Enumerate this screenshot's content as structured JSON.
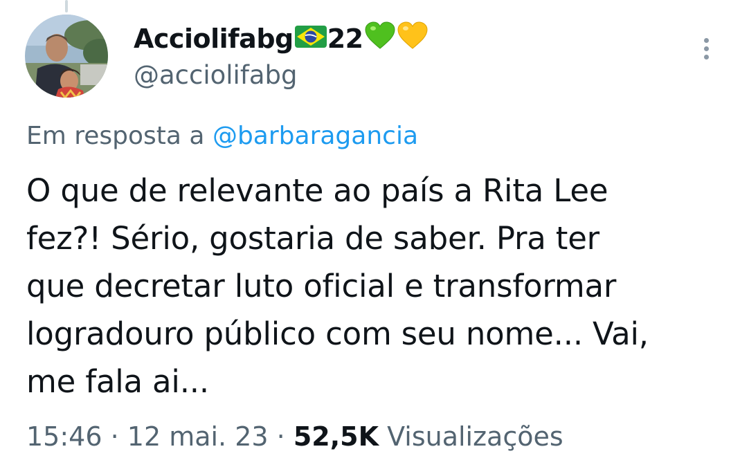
{
  "author": {
    "display_name": "Acciolifabg",
    "name_suffix": "22",
    "name_emojis": [
      "brazil-flag",
      "green-heart",
      "yellow-heart"
    ],
    "handle": "@acciolifabg",
    "avatar_icon": "profile-photo"
  },
  "reply": {
    "prefix": "Em resposta a ",
    "mention": "@barbaragancia"
  },
  "tweet": {
    "lines": [
      "O que de relevante ao país a Rita Lee",
      "fez?! Sério, gostaria de saber. Pra ter",
      "que decretar luto oficial e transformar",
      "logradouro público com seu nome... Vai,",
      "me fala ai..."
    ]
  },
  "meta": {
    "time": "15:46",
    "separator": " · ",
    "date": "12 mai. 23",
    "views_count": "52,5K",
    "views_label": " Visualizações"
  },
  "menu": {
    "icon": "more-vertical-icon"
  },
  "colors": {
    "text": "#0f1419",
    "secondary": "#536471",
    "link": "#1d9bf0",
    "thread_line": "#cfd9de"
  }
}
